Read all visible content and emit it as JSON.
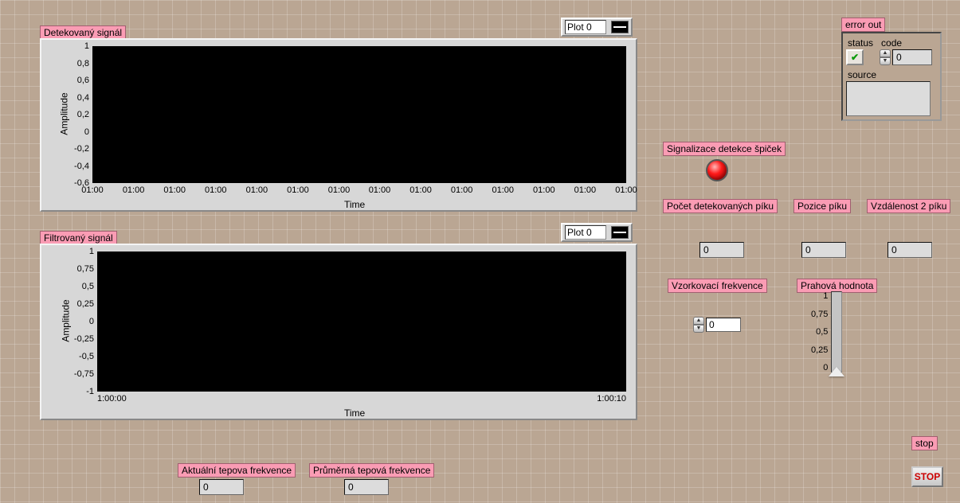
{
  "graph1": {
    "title": "Detekovaný signál",
    "legend": "Plot 0",
    "xlabel": "Time",
    "ylabel": "Amplitude",
    "yticks": [
      "1",
      "0,8",
      "0,6",
      "0,4",
      "0,2",
      "0",
      "-0,2",
      "-0,4",
      "-0,6"
    ],
    "xticks": [
      "01:00",
      "01:00",
      "01:00",
      "01:00",
      "01:00",
      "01:00",
      "01:00",
      "01:00",
      "01:00",
      "01:00",
      "01:00",
      "01:00",
      "01:00",
      "01:00"
    ]
  },
  "graph2": {
    "title": "Filtrovaný signál",
    "legend": "Plot 0",
    "xlabel": "Time",
    "ylabel": "Amplitude",
    "yticks": [
      "1",
      "0,75",
      "0,5",
      "0,25",
      "0",
      "-0,25",
      "-0,5",
      "-0,75",
      "-1"
    ],
    "xstart": "1:00:00",
    "xend": "1:00:10"
  },
  "indicators": {
    "spike_label": "Signalizace detekce špiček",
    "peak_count_label": "Počet detekovaných píku",
    "peak_count_value": "0",
    "peak_pos_label": "Pozice píku",
    "peak_pos_value": "0",
    "peak_dist_label": "Vzdálenost 2 píku",
    "peak_dist_value": "0",
    "samplerate_label": "Vzorkovací frekvence",
    "samplerate_value": "0",
    "threshold_label": "Prahová hodnota",
    "threshold_ticks": [
      "1",
      "0,75",
      "0,5",
      "0,25",
      "0"
    ],
    "current_hr_label": "Aktuální tepova frekvence",
    "current_hr_value": "0",
    "avg_hr_label": "Průměrná tepová frekvence",
    "avg_hr_value": "0"
  },
  "error": {
    "cluster_label": "error out",
    "status_label": "status",
    "code_label": "code",
    "code_value": "0",
    "source_label": "source",
    "source_value": ""
  },
  "stop": {
    "label": "stop",
    "button": "STOP"
  },
  "chart_data": [
    {
      "type": "line",
      "title": "Detekovaný signál",
      "xlabel": "Time",
      "ylabel": "Amplitude",
      "ylim": [
        -0.6,
        1
      ],
      "x": [],
      "series": [
        {
          "name": "Plot 0",
          "values": []
        }
      ]
    },
    {
      "type": "line",
      "title": "Filtrovaný signál",
      "xlabel": "Time",
      "ylabel": "Amplitude",
      "ylim": [
        -1,
        1
      ],
      "x": [],
      "series": [
        {
          "name": "Plot 0",
          "values": []
        }
      ]
    }
  ]
}
